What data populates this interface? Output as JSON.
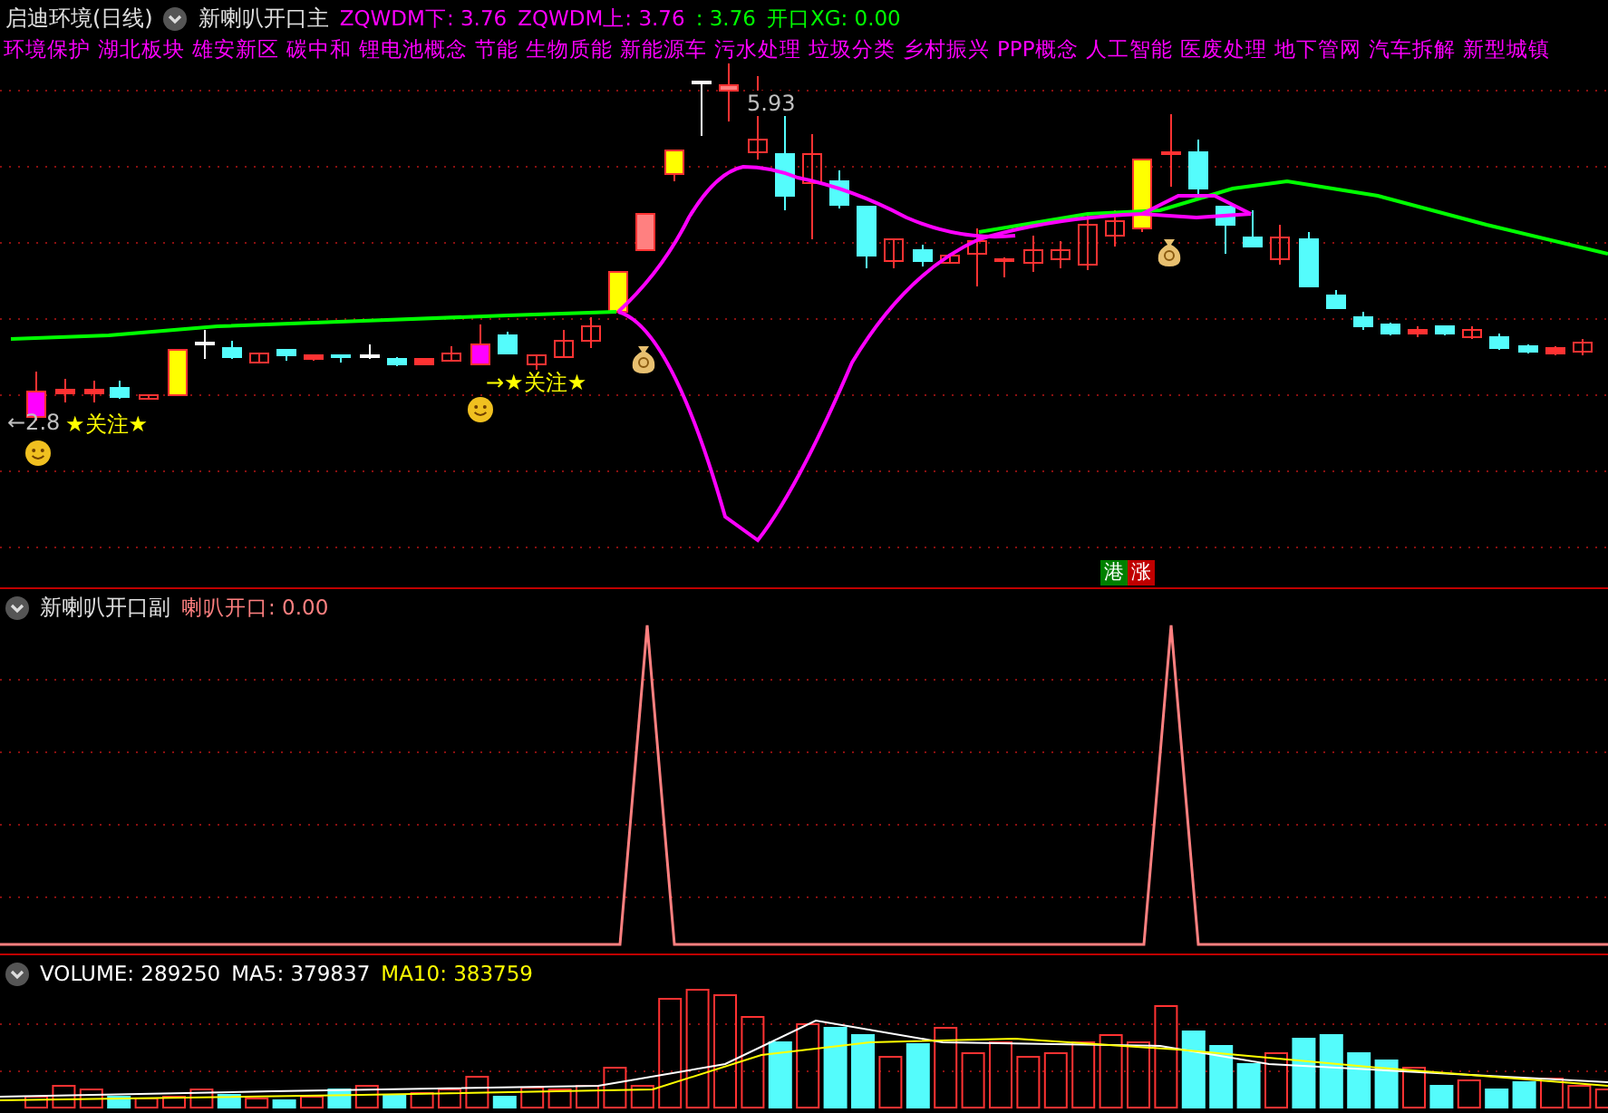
{
  "header": {
    "title": "启迪环境(日线)",
    "indicator": "新喇叭开口主",
    "values": [
      {
        "text": "ZQWDM下: 3.76",
        "color": "#ff00ff"
      },
      {
        "text": "ZQWDM上: 3.76",
        "color": "#ff00ff"
      },
      {
        "text": ": 3.76",
        "color": "#00ff00"
      },
      {
        "text": "开口XG: 0.00",
        "color": "#00ff00"
      }
    ]
  },
  "concepts": [
    "环境保护",
    "湖北板块",
    "雄安新区",
    "碳中和",
    "锂电池概念",
    "节能",
    "生物质能",
    "新能源车",
    "污水处理",
    "垃圾分类",
    "乡村振兴",
    "PPP概念",
    "人工智能",
    "医废处理",
    "地下管网",
    "汽车拆解",
    "新型城镇"
  ],
  "markers": {
    "high_price": "5.93",
    "low_price": "←2.8",
    "focus_left": "★关注★",
    "focus_right": "→★关注★",
    "badges": [
      {
        "text": "港",
        "color": "#008000"
      },
      {
        "text": "涨",
        "color": "#c00000"
      }
    ]
  },
  "sub_panel": {
    "indicator": "新喇叭开口副",
    "values": [
      {
        "text": "喇叭开口: 0.00",
        "color": "#ff8080"
      }
    ]
  },
  "volume_panel": {
    "values": [
      {
        "text": "VOLUME: 289250",
        "color": "#ffffff"
      },
      {
        "text": "MA5: 379837",
        "color": "#ffffff"
      },
      {
        "text": "MA10: 383759",
        "color": "#ffff00"
      }
    ]
  }
}
